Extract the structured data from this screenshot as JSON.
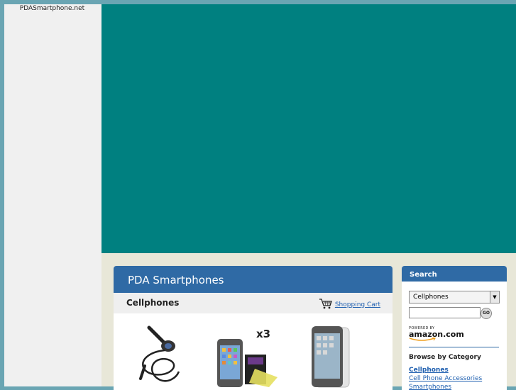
{
  "site": {
    "name": "PDASmartphone.net"
  },
  "main": {
    "title": "PDA Smartphones",
    "section_title": "Cellphones",
    "cart_label": "Shopping Cart",
    "products": [
      {
        "name": "car charger",
        "badge": ""
      },
      {
        "name": "screen protector pack",
        "badge": "x3"
      },
      {
        "name": "clear case",
        "badge": ""
      }
    ]
  },
  "search": {
    "title": "Search",
    "selected_category": "Cellphones",
    "query": "",
    "go_label": "GO",
    "powered_by": "POWERED BY",
    "amazon_logo": "amazon.com"
  },
  "browse": {
    "title": "Browse by Category",
    "categories": [
      "Cellphones",
      "Cell Phone Accessories",
      "Smartphones"
    ]
  },
  "colors": {
    "accent": "#2f6aa5",
    "banner": "#008080",
    "link": "#2060b0"
  }
}
